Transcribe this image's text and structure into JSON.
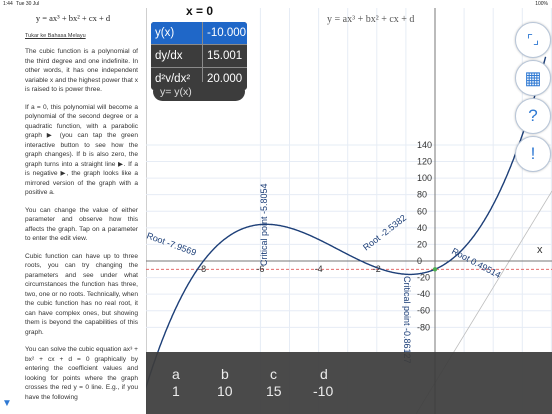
{
  "status": {
    "time": "1:44",
    "date": "Tue 30 Jul",
    "battery": "100%"
  },
  "left": {
    "formula": "y = ax³ + bx² + cx + d",
    "language_link": "Tukar ke Bahasa Melayu",
    "p1": "The cubic function is a polynomial of the third degree and one indefinite. In other words, it has one independent variable x and the highest power that x is raised to is power three.",
    "p2": "If a = 0, this polynomial will become a polynomial of the second degree or a quadratic function, with a parabolic graph ▶ (you can tap the green interactive button to see how the graph changes). If b is also zero, the graph turns into a straight line ▶. If a is negative ▶, the graph looks like a mirrored version of the graph with a positive a.",
    "p3": "You can change the value of either parameter and observe how this affects the graph. Tap on a parameter to enter the edit view.",
    "p4": "Cubic function can have up to three roots, you can try changing the parameters and see under what circumstances the function has three, two, one or no roots. Technically, when the cubic function has no real root, it can have complex ones, but showing them is beyond the capabilities of this graph.",
    "p5": "You can solve the cubic equation ax³ + bx² + cx + d = 0 graphically by entering the coefficient values and looking for points where the graph crosses the red y = 0 line. E.g., if you have the following"
  },
  "panel": {
    "x_title": "x = 0",
    "rows": [
      {
        "label": "y(x)",
        "value": "-10.000"
      },
      {
        "label": "dy/dx",
        "value": "15.001"
      },
      {
        "label": "d²y/dx²",
        "value": "20.000"
      }
    ],
    "expression_pill": "y= y(x)"
  },
  "graph": {
    "formula": "y = ax³ + bx² + cx + d",
    "x_axis_label": "x",
    "x_ticks": [
      {
        "label": "0",
        "v": -10
      },
      {
        "label": "-8",
        "v": -8
      },
      {
        "label": "-6",
        "v": -6
      },
      {
        "label": "-4",
        "v": -4
      },
      {
        "label": "-2",
        "v": -2
      }
    ],
    "y_ticks": [
      {
        "label": "140",
        "v": 140
      },
      {
        "label": "120",
        "v": 120
      },
      {
        "label": "100",
        "v": 100
      },
      {
        "label": "80",
        "v": 80
      },
      {
        "label": "60",
        "v": 60
      },
      {
        "label": "40",
        "v": 40
      },
      {
        "label": "20",
        "v": 20
      },
      {
        "label": "0",
        "v": 0
      },
      {
        "label": "-20",
        "v": -20
      },
      {
        "label": "-40",
        "v": -40
      },
      {
        "label": "-60",
        "v": -60
      },
      {
        "label": "-80",
        "v": -80
      }
    ],
    "annotations": {
      "root1": "Root -7.9569",
      "critical1": "Critical point -5.8054",
      "root2": "Root -2.5382",
      "critical2": "Critical point -0.86127",
      "root3": "Root 0.49514"
    },
    "coefficients": {
      "a": 1,
      "b": 10,
      "c": 15,
      "d": -10
    },
    "colors": {
      "curve": "#1d3f78",
      "zero_line": "#e05555",
      "accent": "#2f79d3",
      "active": "#1f67c8"
    }
  },
  "right_buttons": [
    {
      "name": "fullscreen",
      "glyph": "⌜⌟"
    },
    {
      "name": "calculator",
      "glyph": "▦"
    },
    {
      "name": "help",
      "glyph": "?"
    },
    {
      "name": "info",
      "glyph": "!"
    }
  ],
  "params": {
    "headers": [
      "a",
      "b",
      "c",
      "d"
    ],
    "values": [
      "1",
      "10",
      "15",
      "-10"
    ]
  }
}
